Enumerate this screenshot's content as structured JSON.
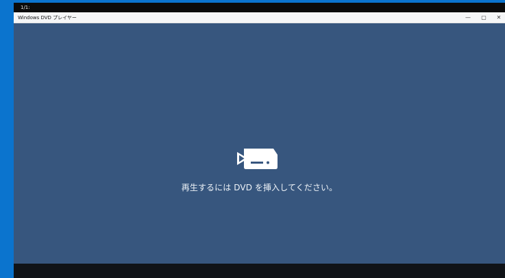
{
  "system": {
    "top_label": "1/1:"
  },
  "window": {
    "title": "Windows DVD プレイヤー",
    "controls": {
      "minimize": "—",
      "restore": "▢",
      "close": "✕"
    }
  },
  "main": {
    "icon": "dvd-drive-icon",
    "message": "再生するには DVD を挿入してください。"
  },
  "colors": {
    "accent": "#0b74ce",
    "content_bg": "#37567e",
    "bottom_bar": "#101318",
    "titlebar_bg": "#f5f6f7"
  }
}
